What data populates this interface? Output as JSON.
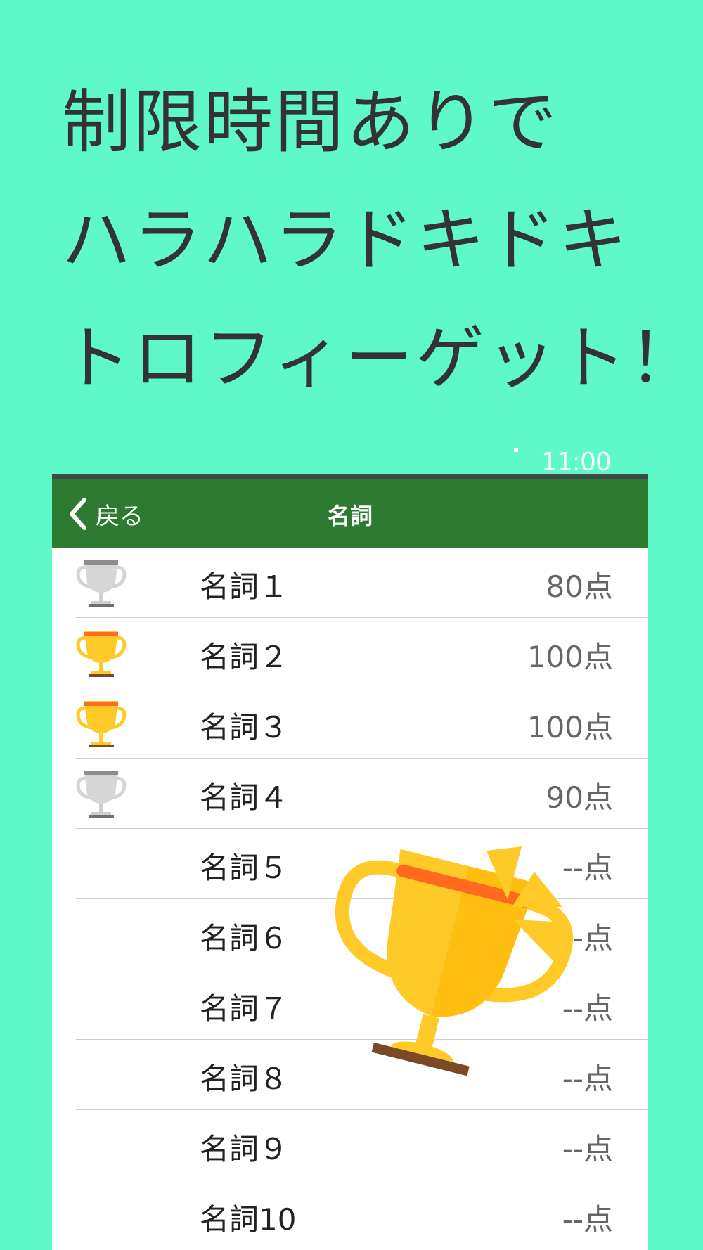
{
  "headline": [
    "制限時間ありで",
    "ハラハラドキドキ",
    "トロフィーゲット！"
  ],
  "statusbar": {
    "time": "11:00"
  },
  "navbar": {
    "back_label": "戻る",
    "title": "名詞"
  },
  "rows": [
    {
      "label": "名詞１",
      "score": "80点",
      "trophy": "silver-trophy-icon"
    },
    {
      "label": "名詞２",
      "score": "100点",
      "trophy": "gold-trophy-icon"
    },
    {
      "label": "名詞３",
      "score": "100点",
      "trophy": "gold-trophy-icon"
    },
    {
      "label": "名詞４",
      "score": "90点",
      "trophy": "silver-trophy-icon"
    },
    {
      "label": "名詞５",
      "score": "--点",
      "trophy": ""
    },
    {
      "label": "名詞６",
      "score": "--点",
      "trophy": ""
    },
    {
      "label": "名詞７",
      "score": "--点",
      "trophy": ""
    },
    {
      "label": "名詞８",
      "score": "--点",
      "trophy": ""
    },
    {
      "label": "名詞９",
      "score": "--点",
      "trophy": ""
    },
    {
      "label": "名詞10",
      "score": "--点",
      "trophy": ""
    }
  ],
  "colors": {
    "background": "#5ff8c9",
    "navbar": "#2e7a31",
    "gold": "#ffc928",
    "silver": "#d0d0d0",
    "ribbon": "#ff6a1f"
  }
}
